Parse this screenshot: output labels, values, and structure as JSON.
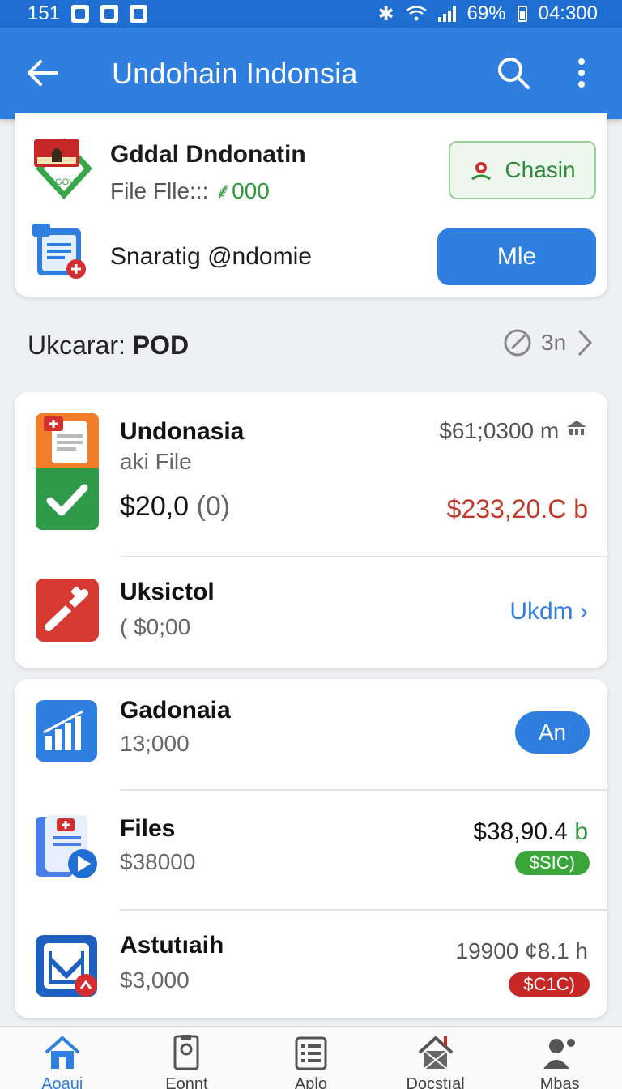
{
  "status_bar": {
    "left_text": "151",
    "battery": "69%",
    "time": "04:300"
  },
  "app_bar": {
    "title": "Undohain Indonsia"
  },
  "top_card": {
    "title": "Gddal Dndonatin",
    "subtitle_prefix": "File Flle:::",
    "subtitle_value": "000",
    "chasin_label": "Chasin",
    "row2_text": "Snaratig @ndomie",
    "mle_label": "Mle"
  },
  "section": {
    "label": "Ukcarar:",
    "value": "POD",
    "right_count": "3n"
  },
  "card2": {
    "items": [
      {
        "title": "Undonasia",
        "subtitle": "aki File",
        "amount": "$20,0",
        "amount_paren": "(0)",
        "right_top": "$61;0300 m",
        "right_bottom": "$233,20.C b"
      },
      {
        "title": "Uksictol",
        "subtitle": "( $0;00",
        "right_link": "Ukdm"
      }
    ]
  },
  "card3": {
    "items": [
      {
        "title": "Gadonaia",
        "subtitle": "13;000",
        "button": "An"
      },
      {
        "title": "Files",
        "subtitle": "$38000",
        "right_top": "$38,90.4",
        "right_top_suffix": "b",
        "badge": "$SIC)",
        "badge_color": "#3aa63a"
      },
      {
        "title": "Astutıaih",
        "subtitle": "$3,000",
        "right_top": "19900 ¢8.1 h",
        "badge": "$C1C)",
        "badge_color": "#c62828"
      }
    ]
  },
  "bottom_nav": [
    {
      "label": "Aoaui",
      "icon": "home-icon",
      "active": true
    },
    {
      "label": "Eonnt",
      "icon": "document-icon",
      "active": false
    },
    {
      "label": "Aplo",
      "icon": "list-icon",
      "active": false
    },
    {
      "label": "Docstıal",
      "icon": "building-icon",
      "active": false
    },
    {
      "label": "Mbas",
      "icon": "people-icon",
      "active": false
    }
  ],
  "colors": {
    "primary": "#2f7fe0",
    "status_bar": "#1e6fd1",
    "positive": "#2e9a3a",
    "negative": "#c0392b"
  }
}
